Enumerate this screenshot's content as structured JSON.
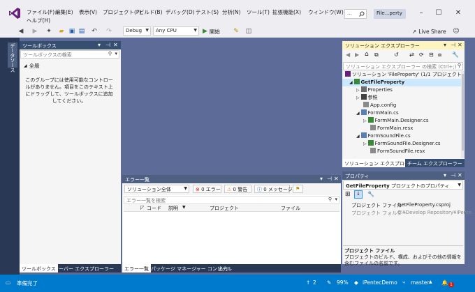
{
  "menu": [
    "ファイル(F)",
    "編集(E)",
    "表示(V)",
    "プロジェクト(P)",
    "ビルド(B)",
    "デバッグ(D)",
    "テスト(S)",
    "分析(N)",
    "ツール(T)",
    "拡張機能(X)",
    "ウィンドウ(W)"
  ],
  "help_menu": "ヘルプ(H)",
  "search_placeholder": "...",
  "solution_badge": "File...perty",
  "toolbar": {
    "config": "Debug",
    "platform": "Any CPU",
    "start": "開始",
    "live_share": "Live Share"
  },
  "toolbox": {
    "side_tab": "データソース",
    "title": "ツールボックス",
    "search_placeholder": "ツールボックスの検索",
    "group": "全般",
    "empty_msg": "このグループには使用可能なコントロールがありません。項目をこのテキスト上にドラッグして、ツールボックスに追加してください。",
    "tabs": [
      "ツールボックス",
      "サーバー エクスプローラー"
    ]
  },
  "error_list": {
    "title": "エラー一覧",
    "scope": "ソリューション全体",
    "errors": "0 エラー",
    "warnings": "0 警告",
    "messages": "0 メッセージ",
    "search_placeholder": "エラー一覧を検索",
    "columns": [
      "コード",
      "説明",
      "プロジェクト",
      "ファイル"
    ],
    "tabs": [
      "エラー一覧",
      "パッケージ マネージャー コンソール",
      "出力"
    ]
  },
  "solution_explorer": {
    "title": "ソリューション エクスプローラー",
    "search_placeholder": "ソリューション エクスプローラー の検索 (Ctrl+;)",
    "items": [
      {
        "label": "ソリューション 'FileProperty' (1/1 プロジェクト)",
        "indent": 0
      },
      {
        "label": "GetFileProperty",
        "indent": 1
      },
      {
        "label": "Properties",
        "indent": 2
      },
      {
        "label": "参照",
        "indent": 2
      },
      {
        "label": "App.config",
        "indent": 2
      },
      {
        "label": "FormMain.cs",
        "indent": 2
      },
      {
        "label": "FormMain.Designer.cs",
        "indent": 3
      },
      {
        "label": "FormMain.resx",
        "indent": 3
      },
      {
        "label": "FormSoundFile.cs",
        "indent": 2
      },
      {
        "label": "FormSoundFile.Designer.cs",
        "indent": 3
      },
      {
        "label": "FormSoundFile.resx",
        "indent": 3
      }
    ],
    "tabs": [
      "ソリューション エクスプローラー",
      "チーム エクスプローラー"
    ]
  },
  "properties": {
    "title": "プロパティ",
    "object_name": "GetFileProperty",
    "object_type": "プロジェクトのプロパティ",
    "rows": [
      {
        "name": "プロジェクト ファイル",
        "value": "GetFileProperty.csproj"
      },
      {
        "name": "プロジェクト フォルダー",
        "value": "C:¥Develop Repository¥iPente"
      }
    ],
    "desc_title": "プロジェクト ファイル",
    "desc_text": "プロジェクトのビルド、構成、およびその他の情報を含むファイルの名前です。"
  },
  "status": {
    "ready": "準備完了",
    "up": "2",
    "zoom": "99%",
    "repo": "iPentecDemo",
    "branch": "master",
    "notify": "1"
  },
  "colors": {
    "accent": "#007acc",
    "panel_title": "#4d6082",
    "active_title": "#fdf4bf",
    "vs_purple": "#68217a"
  }
}
